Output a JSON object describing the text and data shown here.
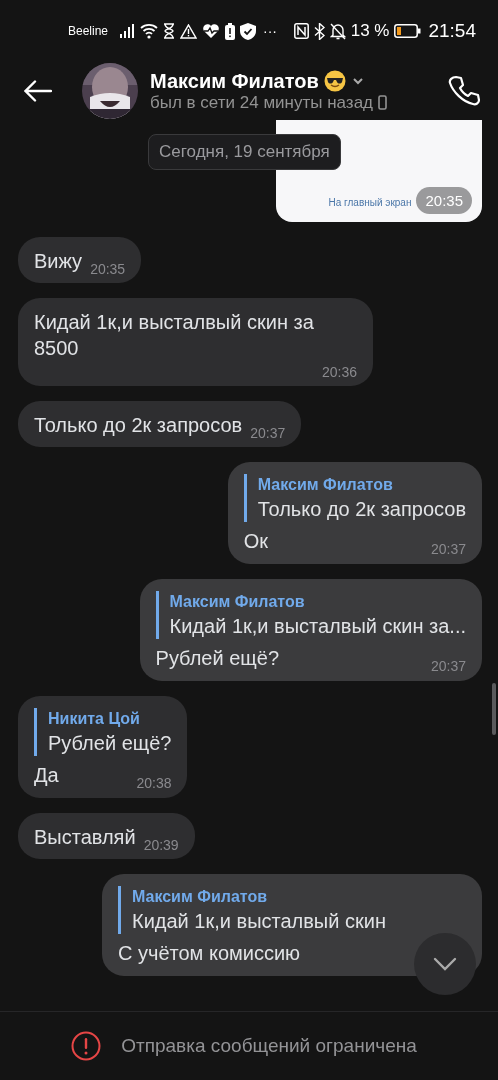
{
  "status_bar": {
    "carrier": "Beeline",
    "overflow": "···",
    "battery_percent": "13 %",
    "time": "21:54"
  },
  "header": {
    "name": "Максим Филатов",
    "status": "был в сети 24 минуты назад"
  },
  "date_pill": "Сегодня, 19 сентября",
  "messages": [
    {
      "outgoing": true,
      "caption": "На главный экран",
      "time": "20:35"
    },
    {
      "kind": "text",
      "outgoing": false,
      "text": "Вижу",
      "time": "20:35"
    },
    {
      "kind": "text",
      "outgoing": false,
      "text": "Кидай 1к,и высталвый скин за 8500",
      "time": "20:36"
    },
    {
      "kind": "text",
      "outgoing": false,
      "text": "Только до 2к запросов",
      "time": "20:37"
    },
    {
      "kind": "reply",
      "outgoing": true,
      "quote_author": "Максим Филатов",
      "quote_text": "Только до 2к запросов",
      "text": "Ок",
      "time": "20:37"
    },
    {
      "kind": "reply",
      "outgoing": true,
      "quote_author": "Максим Филатов",
      "quote_text": "Кидай 1к,и высталвый скин за...",
      "text": "Рублей ещё?",
      "time": "20:37"
    },
    {
      "kind": "reply",
      "outgoing": false,
      "quote_author": "Никита Цой",
      "quote_text": "Рублей ещё?",
      "text": "Да",
      "time": "20:38"
    },
    {
      "kind": "text",
      "outgoing": false,
      "text": "Выставляй",
      "time": "20:39"
    },
    {
      "kind": "reply",
      "outgoing": true,
      "quote_author": "Максим Филатов",
      "quote_text": "Кидай 1к,и высталвый скин",
      "text": "С учётом комиссию"
    }
  ],
  "footer": {
    "notice": "Отправка сообщений ограничена"
  }
}
